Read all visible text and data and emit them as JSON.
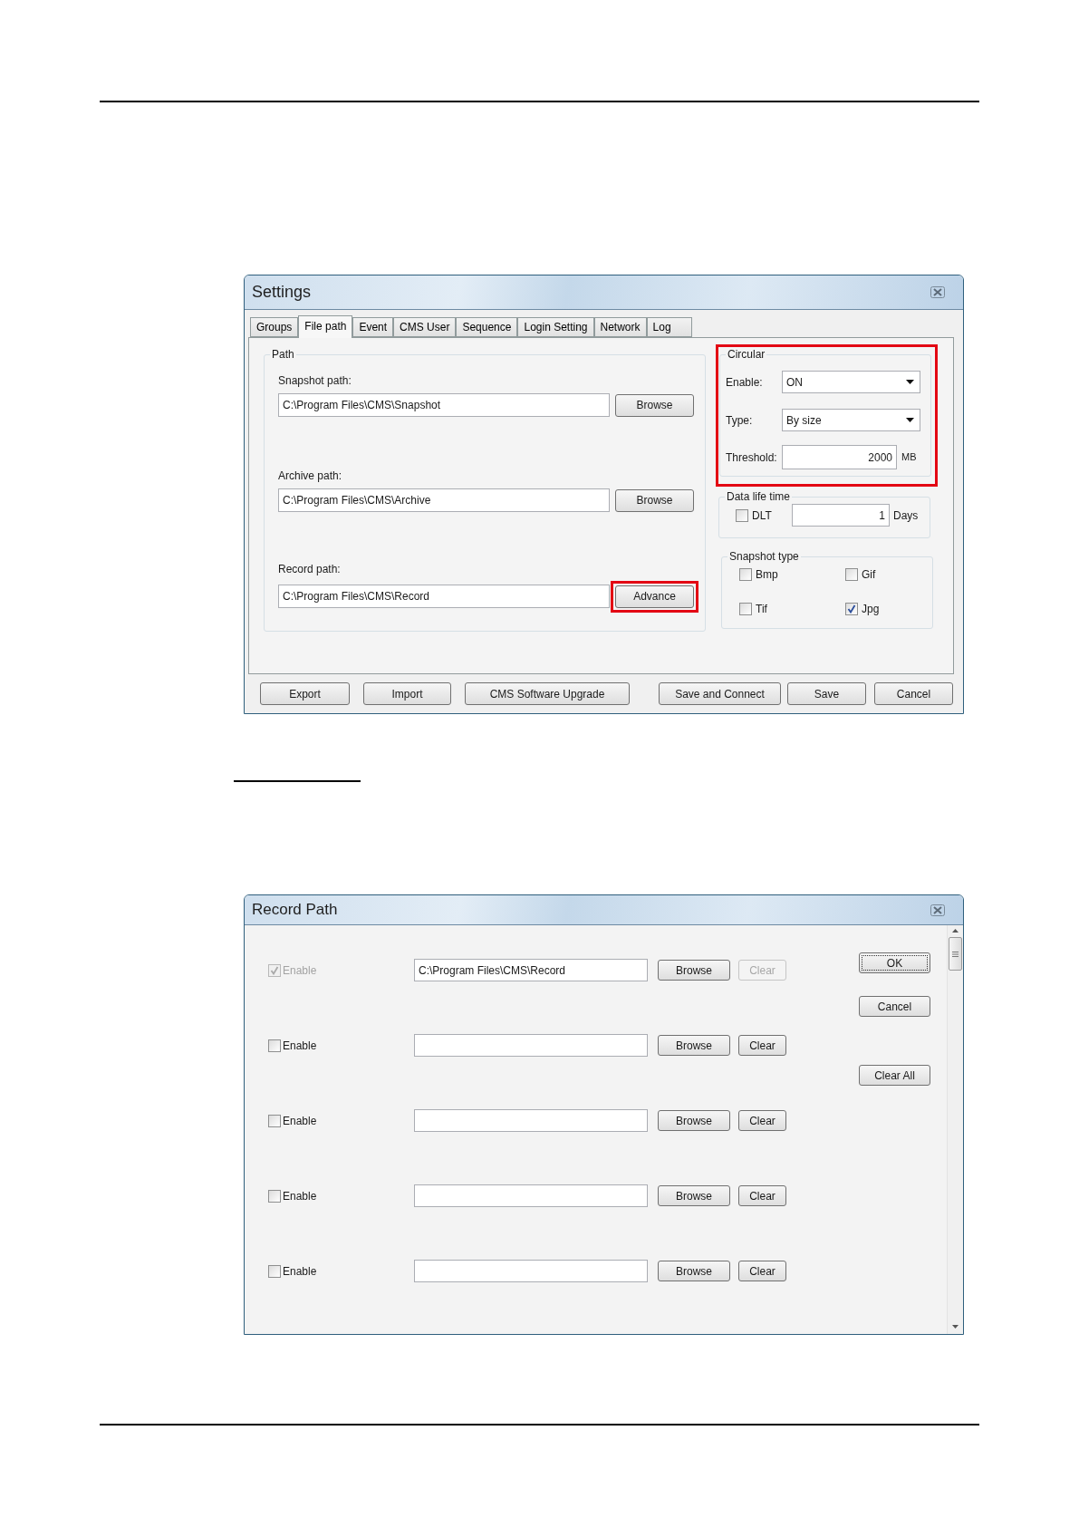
{
  "settings_window": {
    "title": "Settings",
    "tabs": [
      {
        "label": "Groups",
        "selected": false
      },
      {
        "label": "File path",
        "selected": true
      },
      {
        "label": "Event",
        "selected": false
      },
      {
        "label": "CMS User",
        "selected": false
      },
      {
        "label": "Sequence",
        "selected": false
      },
      {
        "label": "Login Setting",
        "selected": false
      },
      {
        "label": "Network",
        "selected": false
      },
      {
        "label": "Log",
        "selected": false
      }
    ],
    "path_group": {
      "title": "Path",
      "rows": [
        {
          "label": "Snapshot path:",
          "value": "C:\\Program Files\\CMS\\Snapshot",
          "button": "Browse",
          "highlighted": false
        },
        {
          "label": "Archive path:",
          "value": "C:\\Program Files\\CMS\\Archive",
          "button": "Browse",
          "highlighted": false
        },
        {
          "label": "Record path:",
          "value": "C:\\Program Files\\CMS\\Record",
          "button": "Advance",
          "highlighted": true
        }
      ]
    },
    "circular_group": {
      "title": "Circular",
      "highlighted": true,
      "enable": {
        "label": "Enable:",
        "value": "ON"
      },
      "type": {
        "label": "Type:",
        "value": "By size"
      },
      "threshold": {
        "label": "Threshold:",
        "value": "2000",
        "unit": "MB"
      }
    },
    "data_life_time": {
      "title": "Data life time",
      "label": "DLT",
      "checked": false,
      "value": "1",
      "unit": "Days"
    },
    "snapshot_type": {
      "title": "Snapshot type",
      "options": [
        {
          "label": "Bmp",
          "checked": false
        },
        {
          "label": "Gif",
          "checked": false
        },
        {
          "label": "Tif",
          "checked": false
        },
        {
          "label": "Jpg",
          "checked": true
        }
      ]
    },
    "buttons": [
      "Export",
      "Import",
      "CMS Software Upgrade",
      "Save and Connect",
      "Save",
      "Cancel"
    ]
  },
  "record_path_window": {
    "title": "Record Path",
    "rows": [
      {
        "label": "Enable",
        "checked": true,
        "disabled": true,
        "path": "C:\\Program Files\\CMS\\Record",
        "browse": "Browse",
        "clear": "Clear"
      },
      {
        "label": "Enable",
        "checked": false,
        "disabled": false,
        "browse": "Browse",
        "clear": "Clear"
      },
      {
        "label": "Enable",
        "checked": false,
        "disabled": false,
        "browse": "Browse",
        "clear": "Clear"
      },
      {
        "label": "Enable",
        "checked": false,
        "disabled": false,
        "browse": "Browse",
        "clear": "Clear"
      },
      {
        "label": "Enable",
        "checked": false,
        "disabled": false,
        "browse": "Browse",
        "clear": "Clear"
      }
    ],
    "buttons": [
      {
        "label": "OK",
        "default": true
      },
      {
        "label": "Cancel",
        "default": false
      },
      {
        "label": "Clear All",
        "default": false
      }
    ]
  }
}
